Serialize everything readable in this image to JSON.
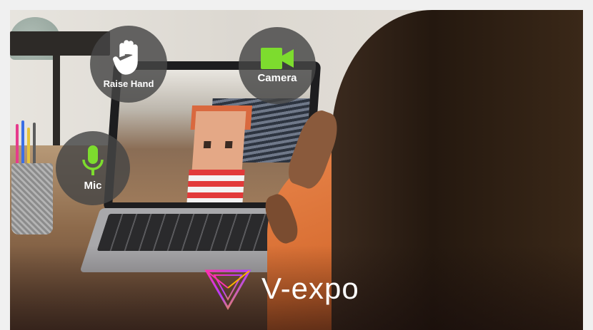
{
  "buttons": {
    "raise_hand": {
      "label": "Raise Hand",
      "icon": "hand-icon"
    },
    "camera": {
      "label": "Camera",
      "icon": "camera-icon",
      "color": "#7ddc2e"
    },
    "mic": {
      "label": "Mic",
      "icon": "microphone-icon",
      "color": "#7ddc2e"
    }
  },
  "brand": {
    "name": "V-expo",
    "logo_icon": "vexpo-logo-icon",
    "logo_colors": [
      "#ff2fb0",
      "#b43cff",
      "#ffb000"
    ]
  }
}
